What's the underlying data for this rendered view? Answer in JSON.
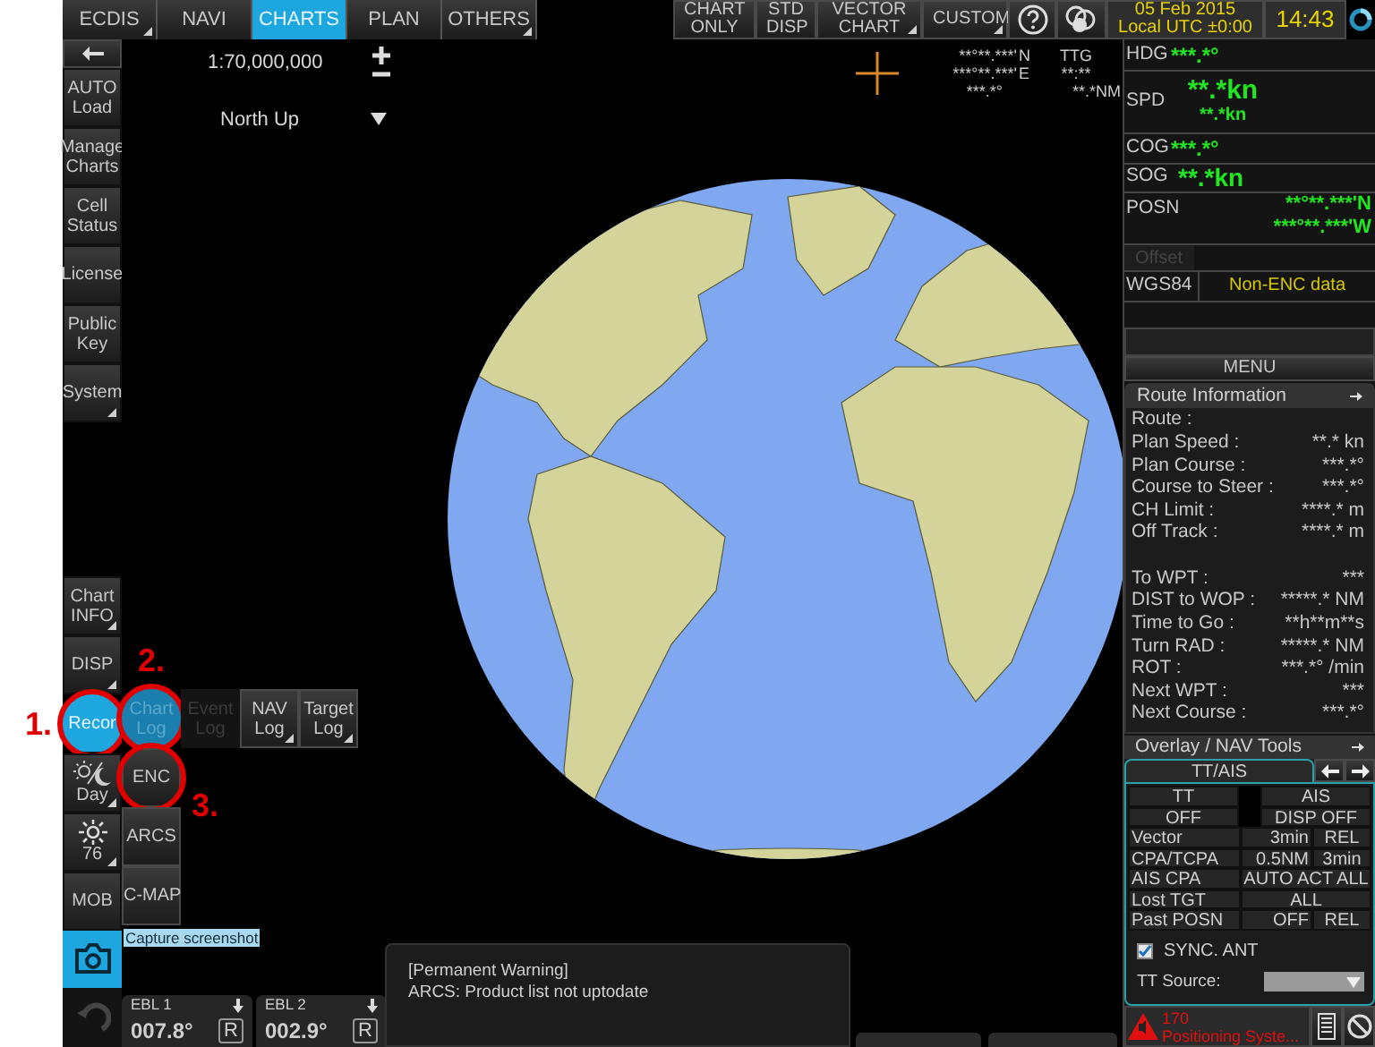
{
  "top_bar": {
    "tabs": [
      {
        "label": "ECDIS",
        "selected": false,
        "submenu": true
      },
      {
        "label": "NAVI",
        "selected": false,
        "submenu": false
      },
      {
        "label": "CHARTS",
        "selected": true,
        "submenu": false
      },
      {
        "label": "PLAN",
        "selected": false,
        "submenu": false
      },
      {
        "label": "OTHERS",
        "selected": false,
        "submenu": true
      }
    ],
    "view_buttons": [
      {
        "label": "CHART ONLY",
        "submenu": false
      },
      {
        "label": "STD DISP",
        "submenu": false
      },
      {
        "label": "VECTOR CHART",
        "submenu": true
      },
      {
        "label": "CUSTOM",
        "submenu": true
      }
    ],
    "date": "05 Feb 2015",
    "utc": "Local UTC ±0:00",
    "time": "14:43"
  },
  "sidebar": {
    "top": [
      {
        "label": "AUTO Load",
        "submenu": false
      },
      {
        "label": "Manage Charts",
        "submenu": false
      },
      {
        "label": "Cell Status",
        "submenu": false
      },
      {
        "label": "License",
        "submenu": false
      },
      {
        "label": "Public Key",
        "submenu": false
      },
      {
        "label": "System",
        "submenu": true
      }
    ],
    "bottom": [
      {
        "kind": "text",
        "label": "Chart INFO",
        "submenu": true,
        "selected": false,
        "circled": false
      },
      {
        "kind": "text",
        "label": "DISP",
        "submenu": true,
        "selected": false,
        "circled": false
      },
      {
        "kind": "text",
        "label": "Recor",
        "submenu": false,
        "selected": true,
        "circled": true,
        "annotation": "1."
      },
      {
        "kind": "day",
        "label": "Day",
        "submenu": true,
        "selected": false,
        "circled": false
      },
      {
        "kind": "brightness",
        "label": "76",
        "submenu": true,
        "selected": false,
        "circled": false
      },
      {
        "kind": "text",
        "label": "MOB",
        "submenu": false,
        "selected": false,
        "circled": false
      },
      {
        "kind": "camera",
        "submenu": false,
        "selected": true,
        "circled": false
      }
    ]
  },
  "record_menu": [
    {
      "label": "Chart Log",
      "selected": true,
      "disabled": false,
      "circled": true,
      "submenu": false,
      "annotation": "2."
    },
    {
      "label": "Event Log",
      "selected": false,
      "disabled": true,
      "circled": false,
      "submenu": false
    },
    {
      "label": "NAV Log",
      "selected": false,
      "disabled": false,
      "circled": false,
      "submenu": true
    },
    {
      "label": "Target Log",
      "selected": false,
      "disabled": false,
      "circled": false,
      "submenu": true
    }
  ],
  "chart_sources": [
    {
      "label": "ENC",
      "circled": true,
      "annotation": "3."
    },
    {
      "label": "ARCS",
      "circled": false
    },
    {
      "label": "C-MAP",
      "circled": false
    }
  ],
  "tooltip": "Capture screenshot",
  "chart": {
    "scale": "1:70,000,000",
    "orientation": "North Up",
    "cursor": {
      "lat": "**°**.***'",
      "lat_hemi": "N",
      "lon": "***°**.***'",
      "lon_hemi": "E",
      "bearing": "***.*°",
      "ttg_label": "TTG",
      "ttg": "**:**",
      "range": "**.*NM"
    }
  },
  "ebl": [
    {
      "label": "EBL 1",
      "value": "007.8°",
      "mode": "R"
    },
    {
      "label": "EBL 2",
      "value": "002.9°",
      "mode": "R"
    }
  ],
  "warning": {
    "title": "[Permanent Warning]",
    "message": "ARCS: Product list not uptodate"
  },
  "own_ship": {
    "hdg_label": "HDG",
    "hdg": "***.*°",
    "spd_label": "SPD",
    "spd": "**.*kn",
    "spd_sub": "**.*kn",
    "cog_label": "COG",
    "cog": "***.*°",
    "sog_label": "SOG",
    "sog": "**.*kn",
    "posn_label": "POSN",
    "lat": "**°**.***'N",
    "lon": "***°**.***'W",
    "offset": "Offset",
    "offset_disabled": true,
    "datum": "WGS84",
    "chart_note": "Non-ENC data"
  },
  "menu": "MENU",
  "route_info": {
    "title": "Route Information",
    "rows": [
      {
        "label": "Route :",
        "gap_before": false
      },
      {
        "label": "Plan Speed :",
        "value": "**.* kn",
        "gap_before": false
      },
      {
        "label": "Plan Course :",
        "value": "***.*°",
        "gap_before": false
      },
      {
        "label": "Course to Steer :",
        "value": "***.*°",
        "gap_before": false
      },
      {
        "label": "CH Limit :",
        "value": "****.* m",
        "gap_before": false
      },
      {
        "label": "Off Track :",
        "value": "****.* m",
        "gap_before": false
      },
      {
        "label": "To WPT :",
        "value": "***",
        "gap_before": true
      },
      {
        "label": "DIST to WOP :",
        "value": "*****.* NM",
        "gap_before": false
      },
      {
        "label": "Time to Go :",
        "value": "**h**m**s",
        "gap_before": false
      },
      {
        "label": "Turn RAD :",
        "value": "*****.* NM",
        "gap_before": false
      },
      {
        "label": "ROT :",
        "value": "***.*° /min",
        "gap_before": false
      },
      {
        "label": "Next WPT :",
        "value": "***",
        "gap_before": false
      },
      {
        "label": "Next Course :",
        "value": "***.*°",
        "gap_before": false
      }
    ]
  },
  "overlay": {
    "title": "Overlay / NAV Tools",
    "tab": "TT/AIS",
    "rows": [
      {
        "kind": "pair",
        "cells": [
          "TT",
          "AIS"
        ]
      },
      {
        "kind": "pair",
        "cells": [
          "OFF",
          "DISP OFF"
        ]
      },
      {
        "kind": "setting",
        "cells": [
          "Vector",
          "3min",
          "REL"
        ]
      },
      {
        "kind": "setting",
        "cells": [
          "CPA/TCPA",
          "0.5NM",
          "3min"
        ]
      },
      {
        "kind": "setting",
        "cells": [
          "AIS CPA",
          "AUTO ACT ALL"
        ]
      },
      {
        "kind": "setting",
        "cells": [
          "Lost TGT",
          "ALL"
        ]
      },
      {
        "kind": "setting",
        "cells": [
          "Past POSN",
          "OFF",
          "REL"
        ]
      }
    ],
    "sync_label": "SYNC. ANT",
    "sync_checked": true,
    "tt_source_label": "TT Source:"
  },
  "alert": {
    "count": "170",
    "text": "Positioning Syste..."
  }
}
